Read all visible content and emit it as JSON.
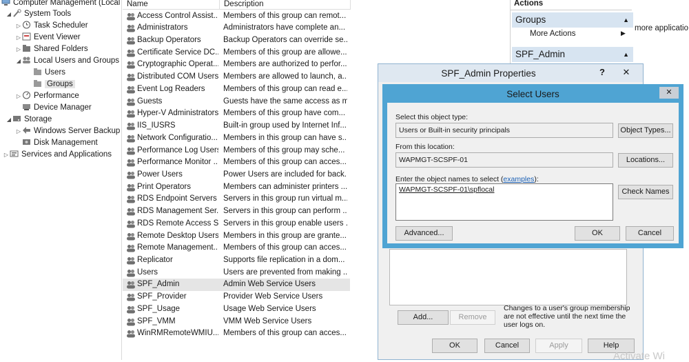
{
  "tree": {
    "root": "Computer Management (Local",
    "system_tools": "System Tools",
    "task_scheduler": "Task Scheduler",
    "event_viewer": "Event Viewer",
    "shared_folders": "Shared Folders",
    "local_users_groups": "Local Users and Groups",
    "users": "Users",
    "groups": "Groups",
    "performance": "Performance",
    "device_manager": "Device Manager",
    "storage": "Storage",
    "wsb": "Windows Server Backup",
    "disk_mgmt": "Disk Management",
    "services_apps": "Services and Applications"
  },
  "list": {
    "col_name": "Name",
    "col_desc": "Description",
    "rows": [
      {
        "name": "Access Control Assist...",
        "desc": "Members of this group can remot..."
      },
      {
        "name": "Administrators",
        "desc": "Administrators have complete an..."
      },
      {
        "name": "Backup Operators",
        "desc": "Backup Operators can override se..."
      },
      {
        "name": "Certificate Service DC...",
        "desc": "Members of this group are allowe..."
      },
      {
        "name": "Cryptographic Operat...",
        "desc": "Members are authorized to perfor..."
      },
      {
        "name": "Distributed COM Users",
        "desc": "Members are allowed to launch, a..."
      },
      {
        "name": "Event Log Readers",
        "desc": "Members of this group can read e..."
      },
      {
        "name": "Guests",
        "desc": "Guests have the same access as m..."
      },
      {
        "name": "Hyper-V Administrators",
        "desc": "Members of this group have com..."
      },
      {
        "name": "IIS_IUSRS",
        "desc": "Built-in group used by Internet Inf..."
      },
      {
        "name": "Network Configuratio...",
        "desc": "Members in this group can have s..."
      },
      {
        "name": "Performance Log Users",
        "desc": "Members of this group may sche..."
      },
      {
        "name": "Performance Monitor ...",
        "desc": "Members of this group can acces..."
      },
      {
        "name": "Power Users",
        "desc": "Power Users are included for back..."
      },
      {
        "name": "Print Operators",
        "desc": "Members can administer printers ..."
      },
      {
        "name": "RDS Endpoint Servers",
        "desc": "Servers in this group run virtual m..."
      },
      {
        "name": "RDS Management Ser...",
        "desc": "Servers in this group can perform ..."
      },
      {
        "name": "RDS Remote Access S...",
        "desc": "Servers in this group enable users ..."
      },
      {
        "name": "Remote Desktop Users",
        "desc": "Members in this group are grante..."
      },
      {
        "name": "Remote Management...",
        "desc": "Members of this group can acces..."
      },
      {
        "name": "Replicator",
        "desc": "Supports file replication in a dom..."
      },
      {
        "name": "Users",
        "desc": "Users are prevented from making ..."
      },
      {
        "name": "SPF_Admin",
        "desc": "Admin Web Service Users"
      },
      {
        "name": "SPF_Provider",
        "desc": "Provider Web Service Users"
      },
      {
        "name": "SPF_Usage",
        "desc": "Usage Web Service Users"
      },
      {
        "name": "SPF_VMM",
        "desc": "VMM Web Service Users"
      },
      {
        "name": "WinRMRemoteWMIU...",
        "desc": "Members of this group can acces..."
      }
    ]
  },
  "actions": {
    "title": "Actions",
    "groups": "Groups",
    "more_actions": "More Actions",
    "spf_admin": "SPF_Admin",
    "behind_text": "more applicatio"
  },
  "props": {
    "title": "SPF_Admin Properties",
    "help_glyph": "?",
    "close_glyph": "✕",
    "add": "Add...",
    "remove": "Remove",
    "note": "Changes to a user's group membership are not effective until the next time the user logs on.",
    "ok": "OK",
    "cancel": "Cancel",
    "apply": "Apply",
    "help": "Help"
  },
  "select": {
    "title": "Select Users",
    "object_type_label": "Select this object type:",
    "object_type_value": "Users or Built-in security principals",
    "object_types_btn": "Object Types...",
    "location_label": "From this location:",
    "location_value": "WAPMGT-SCSPF-01",
    "locations_btn": "Locations...",
    "names_label_pre": "Enter the object names to select (",
    "names_label_link": "examples",
    "names_label_post": "):",
    "names_value": "WAPMGT-SCSPF-01\\spflocal",
    "check_names_btn": "Check Names",
    "advanced_btn": "Advanced...",
    "ok": "OK",
    "cancel": "Cancel",
    "close_glyph": "✕"
  },
  "watermark": "Activate Wi"
}
